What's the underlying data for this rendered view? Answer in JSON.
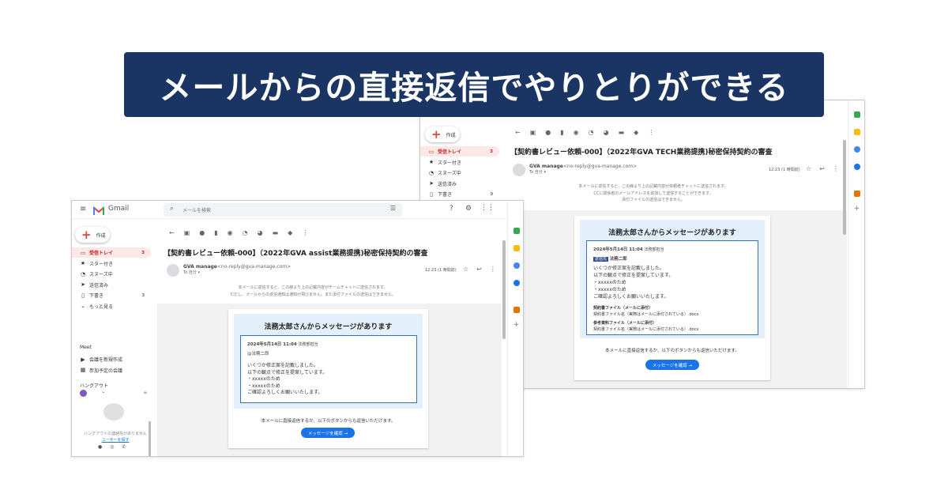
{
  "banner": {
    "title": "メールからの直接返信でやりとりができる"
  },
  "win2": {
    "compose": "作成",
    "nav": [
      {
        "label": "受信トレイ",
        "count": "3",
        "active": true,
        "icon": "inbox-icon",
        "glyph": "▭"
      },
      {
        "label": "スター付き",
        "count": "",
        "active": false,
        "icon": "star-icon",
        "glyph": "★"
      },
      {
        "label": "スヌーズ中",
        "count": "",
        "active": false,
        "icon": "clock-icon",
        "glyph": "◔"
      },
      {
        "label": "送信済み",
        "count": "",
        "active": false,
        "icon": "send-icon",
        "glyph": "➤"
      },
      {
        "label": "下書き",
        "count": "9",
        "active": false,
        "icon": "file-icon",
        "glyph": "▯"
      }
    ],
    "subject": "【契約書レビュー依頼-000】（2022年GVA TECH業務提携)秘密保持契約の審査",
    "sender_name": "GVA manage",
    "sender_email": "<no-reply@gva-manage.com>",
    "to": "To 自分 ▾",
    "time": "12:23 (1 時間前)",
    "notice": [
      "本メールに返信すると、この線より上の記載内容が依頼者チャットに送信されます。",
      "CCに関係者のメールアドレスを追加して送信することができます。",
      "添付ファイルの送信はできません。"
    ],
    "card_title": "法務太郎さんからメッセージがあります",
    "msg_date": "2024年5月14日 11:04",
    "msg_dept": "法務部担当",
    "msg_badge": "返信先",
    "msg_name": "法務二郎",
    "msg_lines": [
      "いくつか修正案を記載しました。",
      "以下の観点で修正を提案しています。",
      "・xxxxxのため",
      "・xxxxxのため",
      "ご確認よろしくお願いいたします。"
    ],
    "file1_label": "契約書ファイル（メールに添付）",
    "file1_name": "契約書ファイル名（実際はメールに添付されている）.docx",
    "file2_label": "参考資料ファイル（メールに添付）",
    "file2_name": "契約書ファイル名（実際はメールに添付されている）.docx",
    "footer": "本メールに直接返信するか、以下のボタンからも返信いただけます。",
    "button": "メッセージを確認 →"
  },
  "win1": {
    "logo": "Gmail",
    "search_placeholder": "メールを検索",
    "compose": "作成",
    "nav": [
      {
        "label": "受信トレイ",
        "count": "3",
        "active": true,
        "icon": "inbox-icon",
        "glyph": "▭"
      },
      {
        "label": "スター付き",
        "count": "",
        "active": false,
        "icon": "star-icon",
        "glyph": "★"
      },
      {
        "label": "スヌーズ中",
        "count": "",
        "active": false,
        "icon": "clock-icon",
        "glyph": "◔"
      },
      {
        "label": "送信済み",
        "count": "",
        "active": false,
        "icon": "send-icon",
        "glyph": "➤"
      },
      {
        "label": "下書き",
        "count": "3",
        "active": false,
        "icon": "file-icon",
        "glyph": "▯"
      },
      {
        "label": "もっと見る",
        "count": "",
        "active": false,
        "icon": "chevron-down-icon",
        "glyph": "⌄"
      }
    ],
    "meet_title": "Meet",
    "meet_items": [
      {
        "label": "会議を新規作成",
        "icon": "video-icon",
        "glyph": "▶"
      },
      {
        "label": "参加予定の会議",
        "icon": "calendar-icon",
        "glyph": "▦"
      }
    ],
    "hangout_title": "ハングアウト",
    "hangout_user": "・",
    "hangout_empty": "ハングアウトの連絡先がありません",
    "hangout_link": "ユーザーを探す",
    "subject": "【契約書レビュー依頼-000】（2022年GVA assist業務提携)秘密保持契約の審査",
    "sender_name": "GVA manage",
    "sender_email": "<no-reply@gva-manage.com>",
    "to": "To 自分 ▾",
    "time": "12:23 (1 時間前)",
    "notice": [
      "本メールに返信すると、この線より上の記載内容がチームチャットに送信されます。",
      "ただし、メールからの返信通知は通知が飛びません。また添付ファイルの送信はできません。"
    ],
    "card_title": "法務太郎さんからメッセージがあります",
    "msg_date": "2024年5月14日 11:04",
    "msg_dept": "法務部担当",
    "msg_to": "@法務二郎",
    "msg_lines": [
      "いくつか修正案を記載しました。",
      "以下の観点で修正を提案しています。",
      "・xxxxxのため",
      "・xxxxxのため",
      "ご確認よろしくお願いいたします。"
    ],
    "footer": "本メールに直接返信するか、以下のボタンからも返信いただけます。",
    "button": "メッセージを確認 →"
  },
  "colors": {
    "banner": "#1a3563",
    "active_nav": "#fce8e6",
    "card_head": "#e3f0fb",
    "button": "#1a73e8",
    "border_blue": "#3b6fb8"
  }
}
